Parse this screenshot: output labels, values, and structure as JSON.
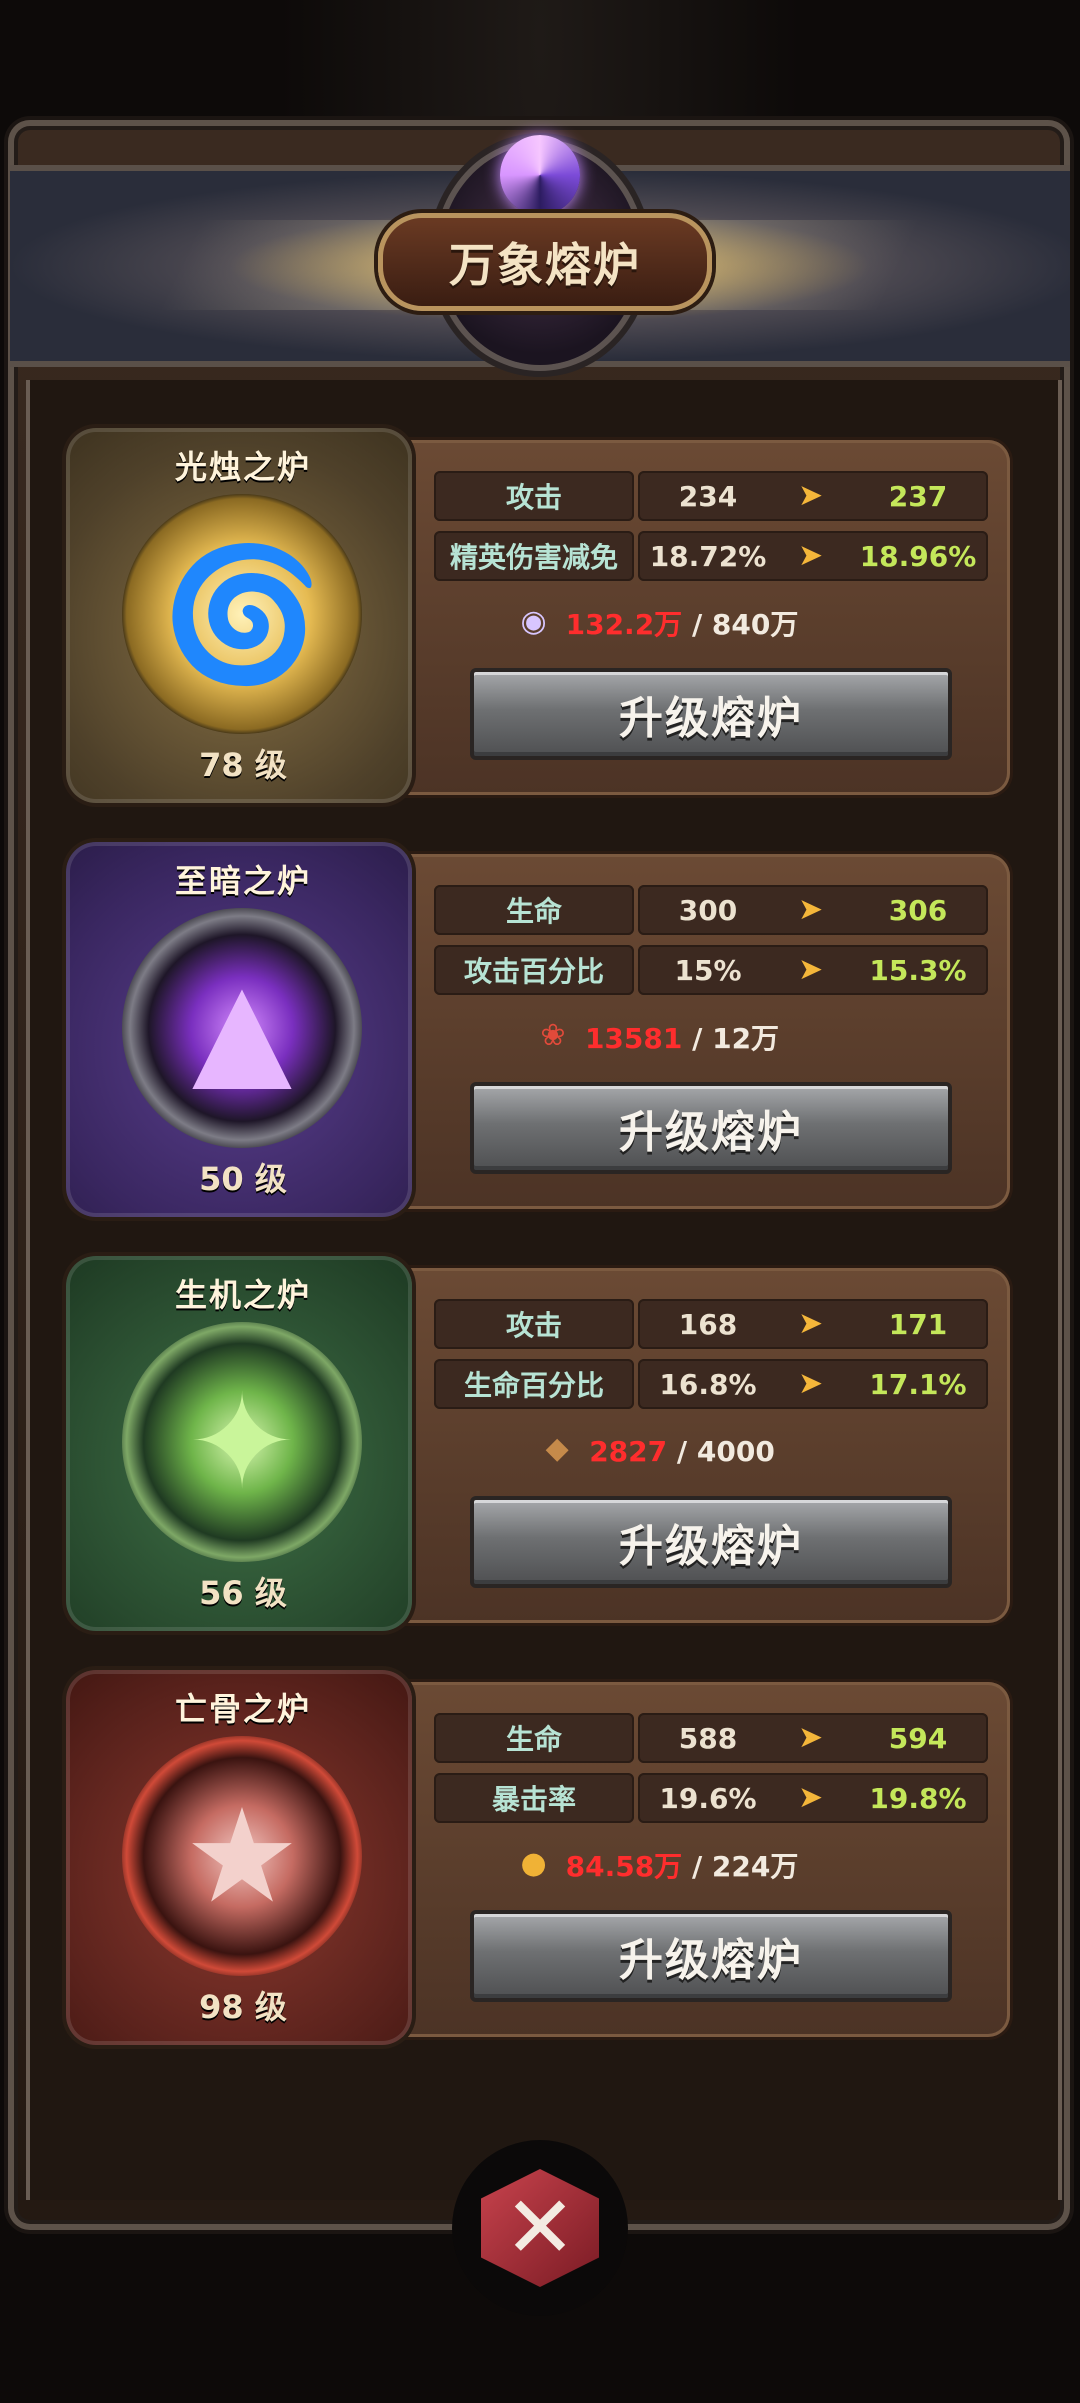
{
  "header": {
    "title": "万象熔炉"
  },
  "furnaces": [
    {
      "name": "光烛之炉",
      "level": "78 级",
      "emblem_icon": "golden-spiral-icon",
      "theme_color": "#6b5a34",
      "stats": [
        {
          "label": "攻击",
          "current": "234",
          "next": "237"
        },
        {
          "label": "精英伤害减免",
          "current": "18.72%",
          "next": "18.96%"
        }
      ],
      "cost_icon": "exp-icon",
      "cost_have": "132.2万",
      "cost_need": "/ 840万",
      "button_label": "升级熔炉"
    },
    {
      "name": "至暗之炉",
      "level": "50 级",
      "emblem_icon": "dark-triangle-icon",
      "theme_color": "#3e2c68",
      "stats": [
        {
          "label": "生命",
          "current": "300",
          "next": "306"
        },
        {
          "label": "攻击百分比",
          "current": "15%",
          "next": "15.3%"
        }
      ],
      "cost_icon": "flower-icon",
      "cost_have": "13581",
      "cost_need": "/ 12万",
      "button_label": "升级熔炉"
    },
    {
      "name": "生机之炉",
      "level": "56 级",
      "emblem_icon": "green-leaf-star-icon",
      "theme_color": "#2e5234",
      "stats": [
        {
          "label": "攻击",
          "current": "168",
          "next": "171"
        },
        {
          "label": "生命百分比",
          "current": "16.8%",
          "next": "17.1%"
        }
      ],
      "cost_icon": "material-icon",
      "cost_have": "2827",
      "cost_need": "/ 4000",
      "button_label": "升级熔炉"
    },
    {
      "name": "亡骨之炉",
      "level": "98 级",
      "emblem_icon": "red-star-icon",
      "theme_color": "#6a2620",
      "stats": [
        {
          "label": "生命",
          "current": "588",
          "next": "594"
        },
        {
          "label": "暴击率",
          "current": "19.6%",
          "next": "19.8%"
        }
      ],
      "cost_icon": "gold-coin-icon",
      "cost_have": "84.58万",
      "cost_need": "/ 224万",
      "button_label": "升级熔炉"
    }
  ],
  "arrow_glyph": "➤",
  "close": {
    "icon": "close-icon",
    "glyph": "✕"
  },
  "colors": {
    "accent_value": "#c4e75a",
    "insufficient": "#ff2d2d",
    "stat_label": "#b7e3d4"
  }
}
